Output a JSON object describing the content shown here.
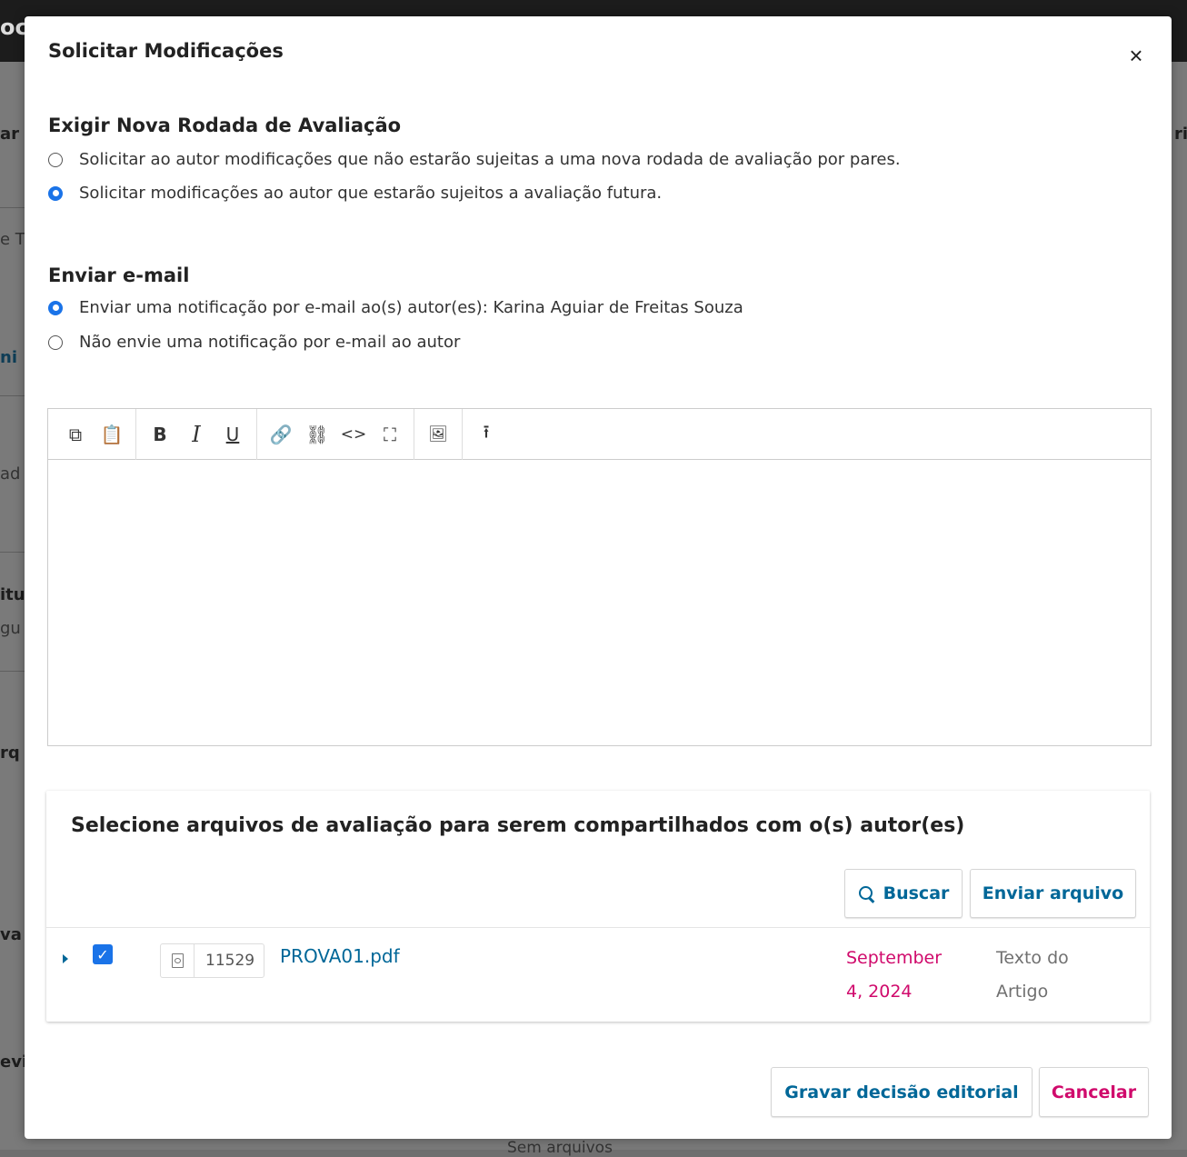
{
  "background": {
    "fragments": [
      "oc",
      "ar",
      "e T",
      "ni",
      "ad",
      "itu",
      "gu",
      "rq",
      "va",
      "evi",
      "ri",
      "Sem arquivos"
    ]
  },
  "modal": {
    "title": "Solicitar Modificações",
    "close_label": "×"
  },
  "review_round": {
    "heading": "Exigir Nova Rodada de Avaliação",
    "options": [
      {
        "label": "Solicitar ao autor modificações que não estarão sujeitas a uma nova rodada de avaliação por pares.",
        "checked": false
      },
      {
        "label": "Solicitar modificações ao autor que estarão sujeitos a avaliação futura.",
        "checked": true
      }
    ]
  },
  "email": {
    "heading": "Enviar e-mail",
    "options": [
      {
        "label": "Enviar uma notificação por e-mail ao(s) autor(es): Karina Aguiar de Freitas Souza",
        "checked": true
      },
      {
        "label": "Não envie uma notificação por e-mail ao autor",
        "checked": false
      }
    ]
  },
  "editor": {
    "toolbar": {
      "copy": "⧉",
      "paste": "📋",
      "bold": "B",
      "italic": "I",
      "underline": "U",
      "link": "🔗",
      "unlink": "⛓",
      "code": "<>",
      "fullscreen": "⛶",
      "image": "🖼",
      "upload": "⭱"
    },
    "content": ""
  },
  "files": {
    "title": "Selecione arquivos de avaliação para serem compartilhados com o(s) autor(es)",
    "search_label": "Buscar",
    "upload_label": "Enviar arquivo",
    "rows": [
      {
        "checked": true,
        "id": "11529",
        "name": "PROVA01.pdf",
        "date_line1": "September",
        "date_line2": "4, 2024",
        "type_line1": "Texto do",
        "type_line2": "Artigo"
      }
    ]
  },
  "footer": {
    "save_label": "Gravar decisão editorial",
    "cancel_label": "Cancelar"
  },
  "colors": {
    "accent": "#006798",
    "danger": "#d00a6c",
    "radio_checked": "#1a73e8"
  }
}
